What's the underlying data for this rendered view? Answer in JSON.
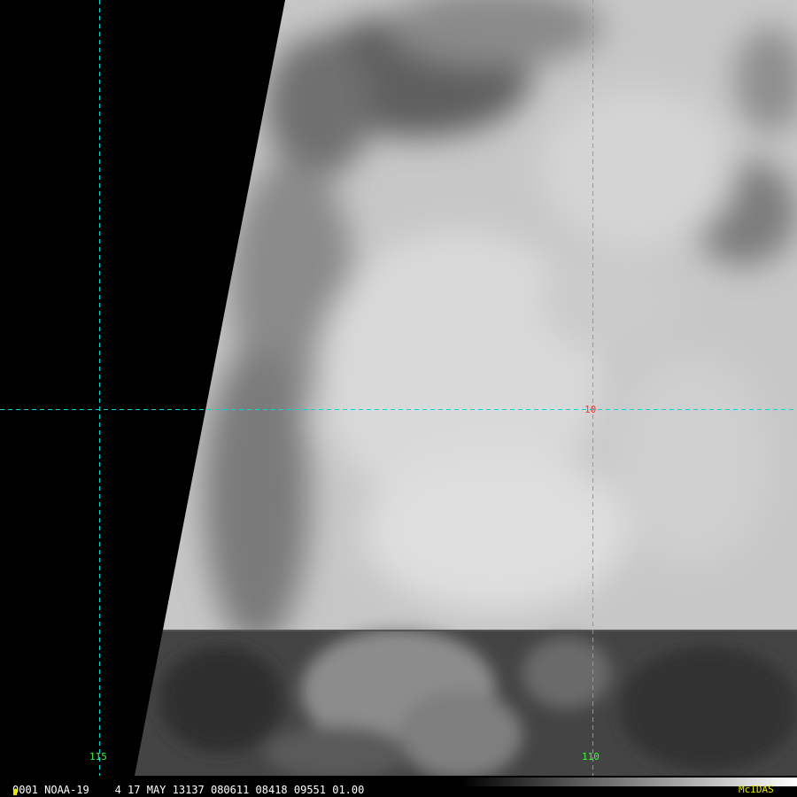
{
  "colors": {
    "gridline": "#00d8d8",
    "latitude_label": "#ff3030",
    "longitude_label": "#33ff33",
    "footer_text": "#ffffff",
    "logo": "#e6e600",
    "no_data": "#000000"
  },
  "grid": {
    "latitude_labels": [
      "10"
    ],
    "longitude_labels": [
      "115",
      "110"
    ]
  },
  "footer": {
    "info_line": "0001 NOAA-19    4 17 MAY 13137 080611 08418 09551 01.00",
    "logo_text": "McIDAS"
  }
}
